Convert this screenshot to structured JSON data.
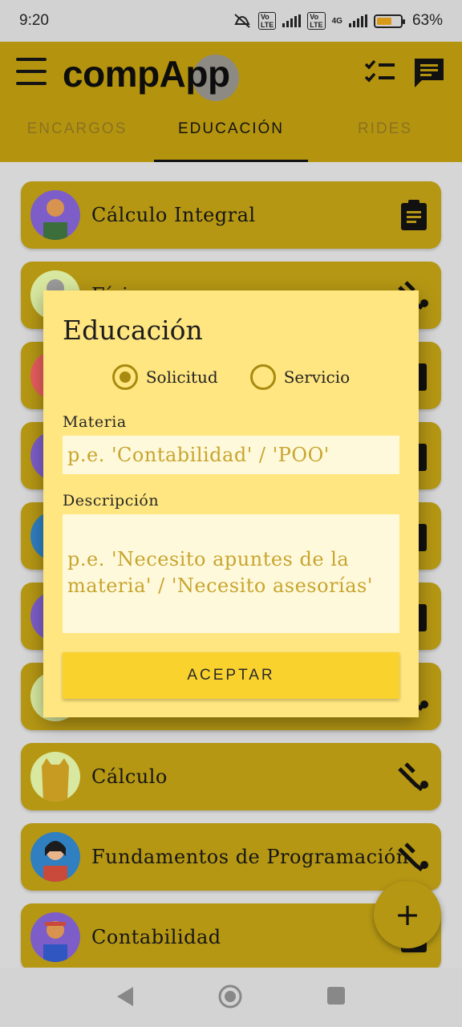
{
  "status_bar": {
    "time": "9:20",
    "battery": "63%",
    "network": "4G",
    "volte": "Vo LTE"
  },
  "app_bar": {
    "logo_text": "compApp",
    "menu_icon": "hamburger-menu-icon",
    "actions": [
      {
        "name": "checklist-icon"
      },
      {
        "name": "chat-icon"
      }
    ],
    "tabs": [
      {
        "label": "ENCARGOS",
        "active": false
      },
      {
        "label": "EDUCACIÓN",
        "active": true
      },
      {
        "label": "RIDES",
        "active": false
      }
    ]
  },
  "list": {
    "items": [
      {
        "title": "Cálculo Integral",
        "icon": "clipboard-icon",
        "avatar_bg": "#7d5ec9"
      },
      {
        "title": "Física",
        "icon": "handshake-icon",
        "avatar_bg": "#d8e8a0"
      },
      {
        "title": "",
        "icon": "clipboard-icon",
        "avatar_bg": "#e85d5d"
      },
      {
        "title": "",
        "icon": "clipboard-icon",
        "avatar_bg": "#7d5ec9"
      },
      {
        "title": "",
        "icon": "clipboard-icon",
        "avatar_bg": "#2f7fc1"
      },
      {
        "title": "",
        "icon": "clipboard-icon",
        "avatar_bg": "#7d5ec9"
      },
      {
        "title": "",
        "icon": "handshake-icon",
        "avatar_bg": "#d8e8a0"
      },
      {
        "title": "Cálculo",
        "icon": "handshake-icon",
        "avatar_bg": "#d8e8a0"
      },
      {
        "title": "Fundamentos de Programación",
        "icon": "handshake-icon",
        "avatar_bg": "#2f7fc1"
      },
      {
        "title": "Contabilidad",
        "icon": "clipboard-icon",
        "avatar_bg": "#7d5ec9"
      }
    ]
  },
  "fab": {
    "label": "+"
  },
  "dialog": {
    "title": "Educación",
    "radio_options": [
      {
        "label": "Solicitud",
        "selected": true
      },
      {
        "label": "Servicio",
        "selected": false
      }
    ],
    "materia_label": "Materia",
    "materia_placeholder": "p.e. 'Contabilidad' / 'POO'",
    "descripcion_label": "Descripción",
    "descripcion_placeholder_line1": "p.e. 'Necesito apuntes de la",
    "descripcion_placeholder_line2": "materia' / 'Necesito asesorías'",
    "accept_label": "ACEPTAR"
  },
  "colors": {
    "app_bar": "#b4940f",
    "dialog_bg": "#ffe680",
    "accent": "#f9d22e",
    "placeholder": "#c7a52e"
  }
}
